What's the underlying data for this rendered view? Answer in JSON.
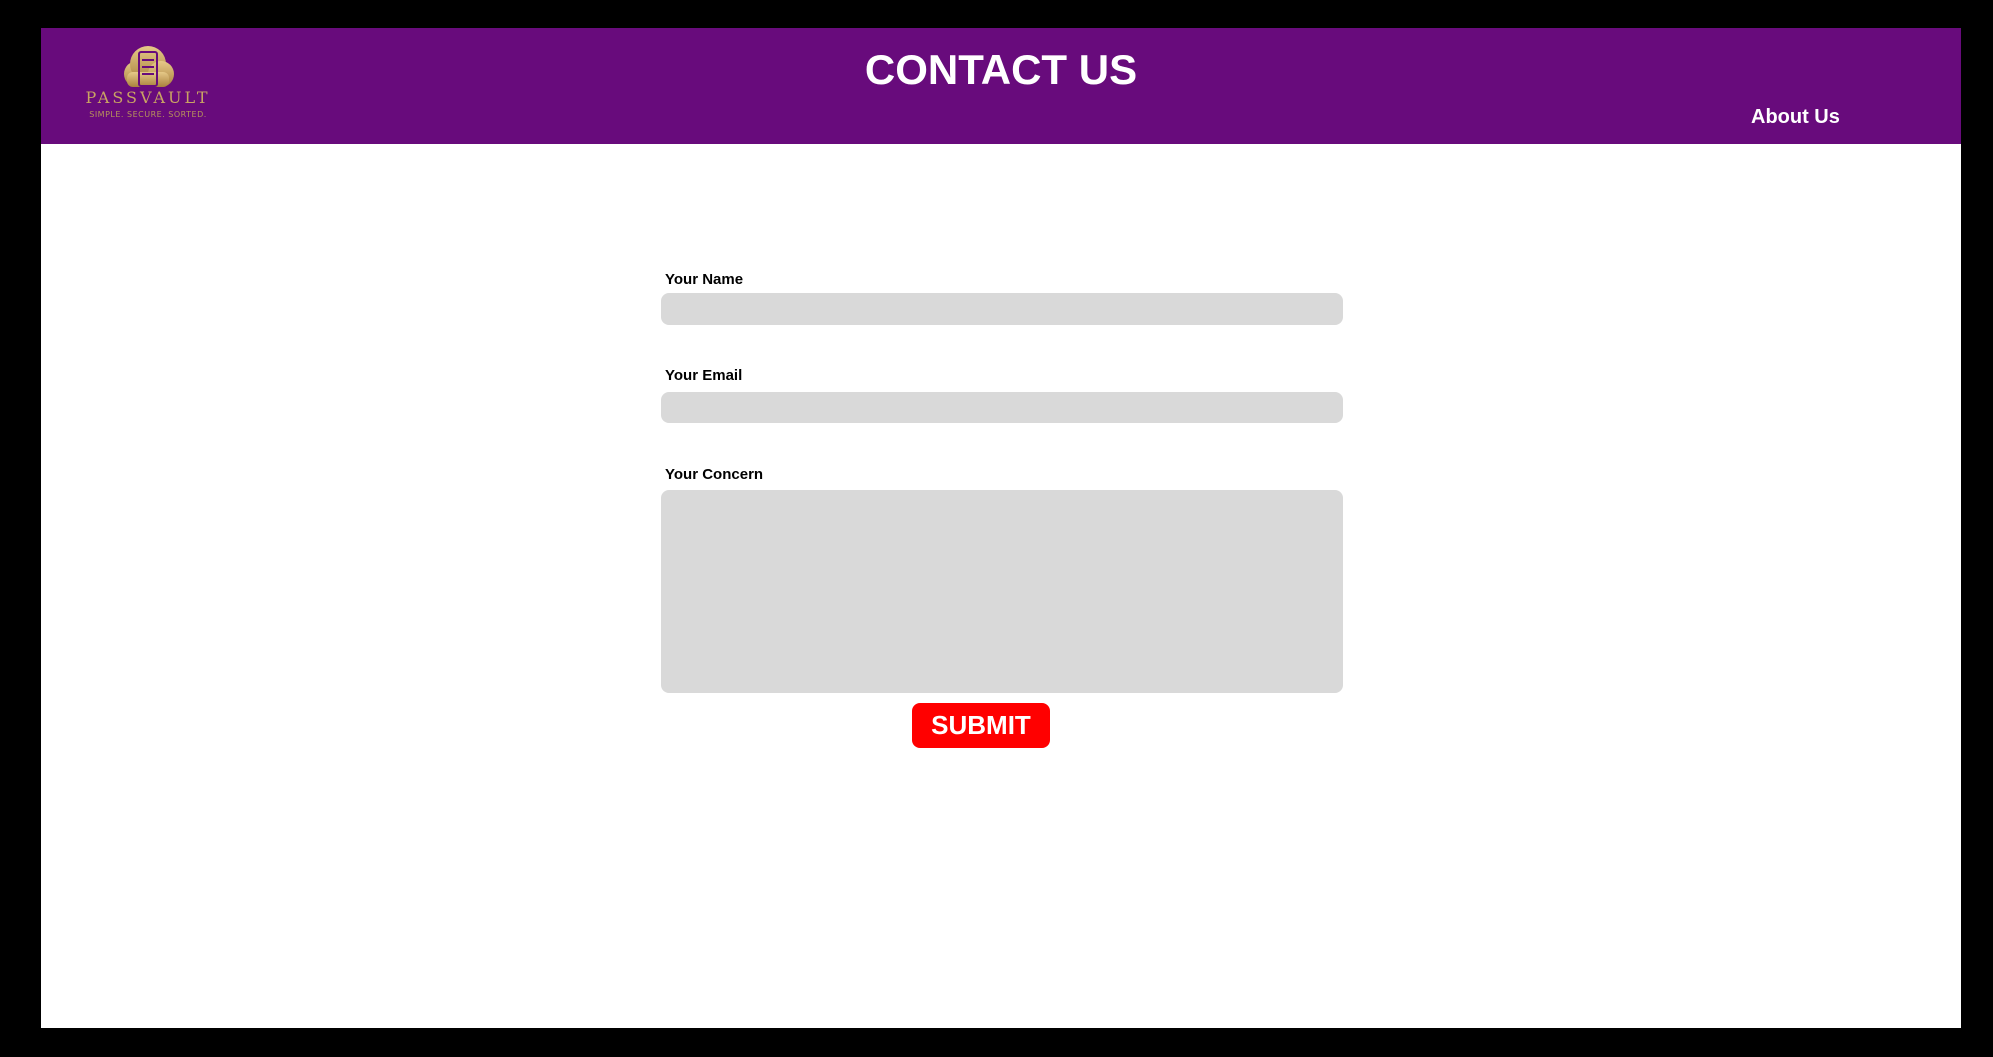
{
  "header": {
    "title": "CONTACT US",
    "background_color": "#680b7c",
    "logo": {
      "icon": "cloud-server-icon",
      "wordmark": "PASSVAULT",
      "tagline": "SIMPLE. SECURE. SORTED."
    },
    "nav": {
      "about_label": "About Us"
    }
  },
  "form": {
    "name": {
      "label": "Your Name",
      "value": "",
      "placeholder": ""
    },
    "email": {
      "label": "Your Email",
      "value": "",
      "placeholder": ""
    },
    "concern": {
      "label": "Your Concern",
      "value": "",
      "placeholder": ""
    },
    "submit_label": "SUBMIT",
    "submit_color": "#ff0000",
    "field_color": "#d9d9d9"
  }
}
